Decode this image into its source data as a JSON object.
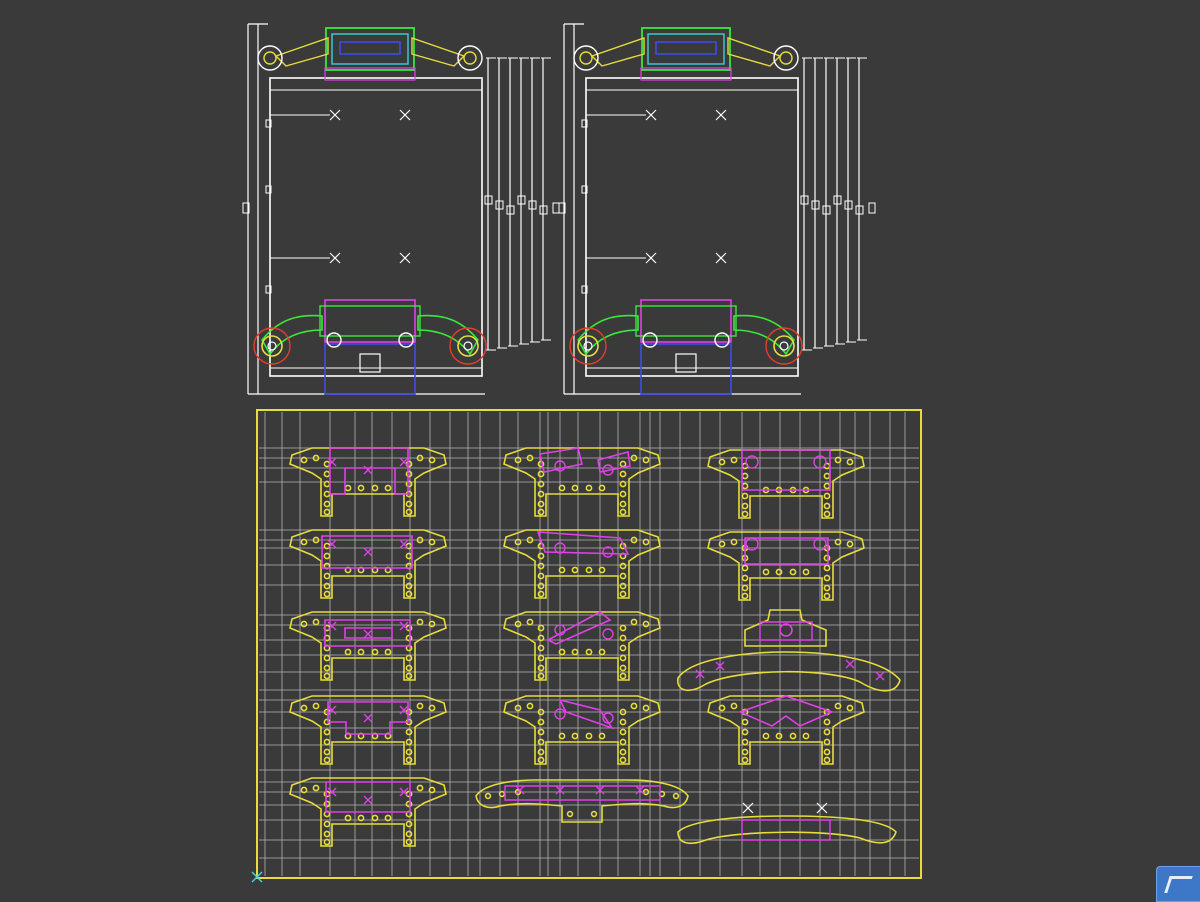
{
  "colors": {
    "background": "#3a3a3a",
    "frame": "#ffffff",
    "guide": "#b4b4b4",
    "sheet_border": "#e6dc3c",
    "part": "#e6dc3c",
    "feature": "#e040e8",
    "green": "#3ce63c",
    "blue": "#3c4ce6",
    "cyan": "#3cdcdc",
    "red": "#e63c2c"
  },
  "icons": {
    "origin": "ucs-origin-icon",
    "viewcube": "viewcube-icon"
  }
}
